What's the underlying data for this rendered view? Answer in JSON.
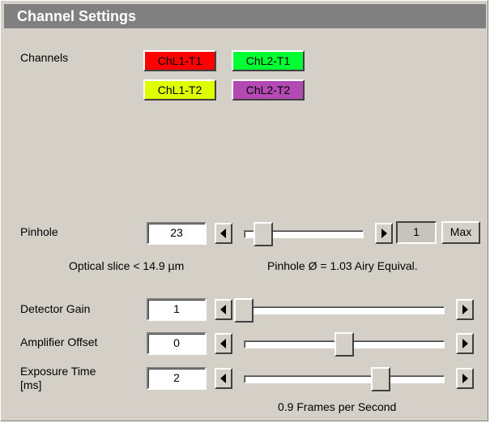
{
  "title": "Channel Settings",
  "channels": {
    "label": "Channels",
    "items": [
      {
        "label": "ChL1-T1",
        "color": "#ff0000"
      },
      {
        "label": "ChL2-T1",
        "color": "#00ff33"
      },
      {
        "label": "ChL1-T2",
        "color": "#ddff00"
      },
      {
        "label": "ChL2-T2",
        "color": "#b34ab3"
      }
    ]
  },
  "pinhole": {
    "label": "Pinhole",
    "value": "23",
    "slider_fraction": 0.1,
    "step_button": "1",
    "max_button": "Max",
    "optical_slice": "Optical slice < 14.9 µm",
    "airy": "Pinhole Ø = 1.03 Airy Equival."
  },
  "detector_gain": {
    "label": "Detector Gain",
    "value": "1",
    "slider_fraction": 0.0
  },
  "amplifier_offset": {
    "label": "Amplifier Offset",
    "value": "0",
    "slider_fraction": 0.5
  },
  "exposure_time": {
    "label_line1": "Exposure Time",
    "label_line2": "[ms]",
    "value": "2",
    "slider_fraction": 0.7
  },
  "frames_per_second": "0.9 Frames per Second",
  "icons": {
    "left_arrow": "arrow-left-icon",
    "right_arrow": "arrow-right-icon"
  }
}
